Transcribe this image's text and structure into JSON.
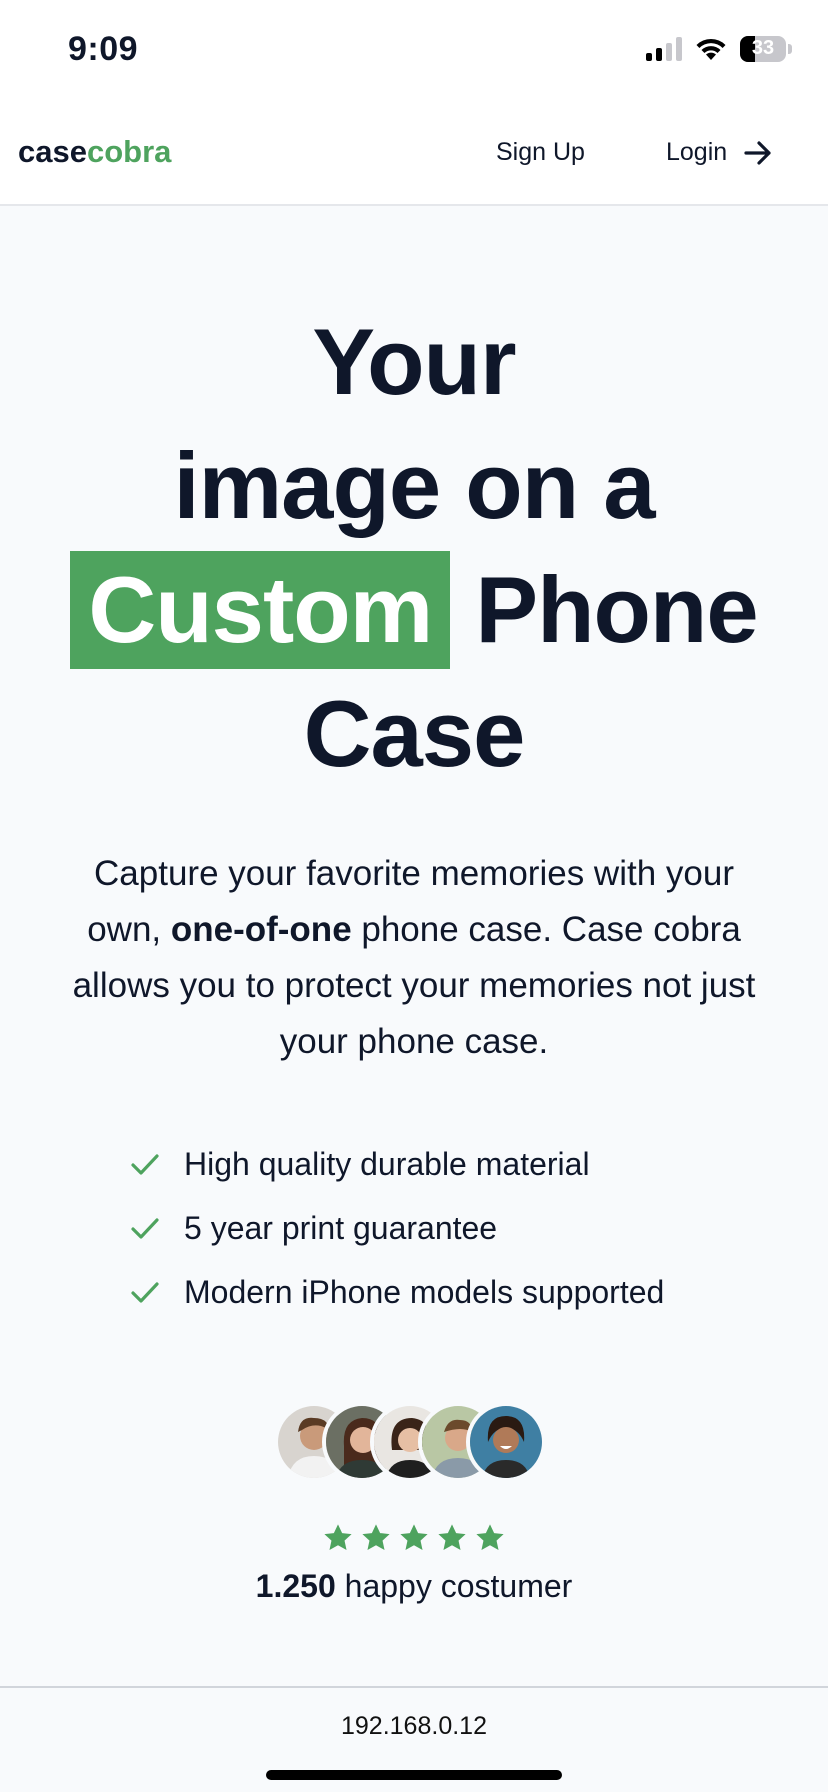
{
  "status_bar": {
    "time": "9:09",
    "battery": "33",
    "battery_level": 0.33
  },
  "nav": {
    "logo_part1": "case",
    "logo_part2": "cobra",
    "signup_label": "Sign Up",
    "login_label": "Login"
  },
  "hero": {
    "line1": "Your",
    "line2": "image on a",
    "highlight": "Custom",
    "line3_rest": " Phone",
    "line4": "Case",
    "desc_part1": "Capture your favorite memories with your own, ",
    "desc_bold": "one-of-one",
    "desc_part2": " phone case. Case cobra allows you to protect your memories not just your phone case."
  },
  "features": [
    "High quality durable material",
    "5 year print guarantee",
    "Modern iPhone models supported"
  ],
  "reviews": {
    "rating": 5,
    "count": "1.250",
    "label": " happy costumer"
  },
  "browser": {
    "address": "192.168.0.12"
  },
  "colors": {
    "accent": "#4ea35e",
    "text": "#0f172a",
    "background": "#f8fafc"
  }
}
